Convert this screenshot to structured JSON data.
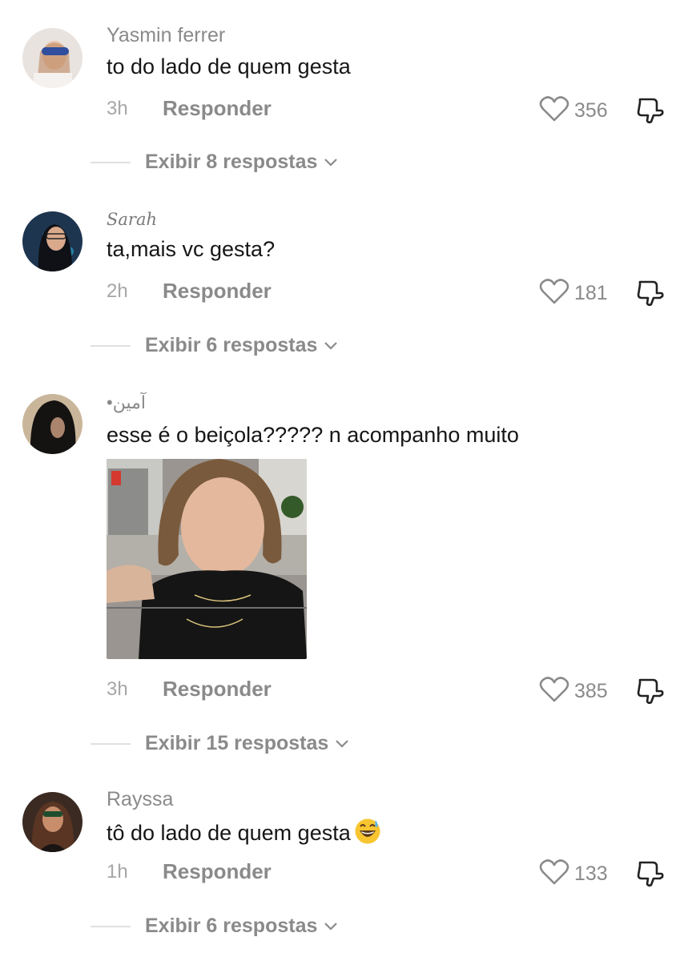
{
  "comments": [
    {
      "username": "Yasmin ferrer",
      "text": "to do lado de quem gesta",
      "time": "3h",
      "reply_label": "Responder",
      "likes": "356",
      "view_replies": "Exibir 8 respostas"
    },
    {
      "username": "Sarah",
      "text": "ta,mais vc gesta?",
      "time": "2h",
      "reply_label": "Responder",
      "likes": "181",
      "view_replies": "Exibir 6 respostas"
    },
    {
      "username": "•آمين",
      "text": "esse é o beiçola????? n acompanho muito",
      "time": "3h",
      "reply_label": "Responder",
      "likes": "385",
      "view_replies": "Exibir 15 respostas"
    },
    {
      "username": "Rayssa",
      "text": "tô do lado de quem gesta",
      "time": "1h",
      "reply_label": "Responder",
      "likes": "133",
      "view_replies": "Exibir 6 respostas"
    }
  ],
  "icons": {
    "like": "heart-outline-icon",
    "dislike": "thumbs-down-icon",
    "expand": "chevron-down-icon",
    "emoji": "grinning-sweat-emoji"
  },
  "colors": {
    "secondary_text": "#8a8a8a",
    "primary_text": "#161616",
    "divider": "#e0e0e0"
  }
}
